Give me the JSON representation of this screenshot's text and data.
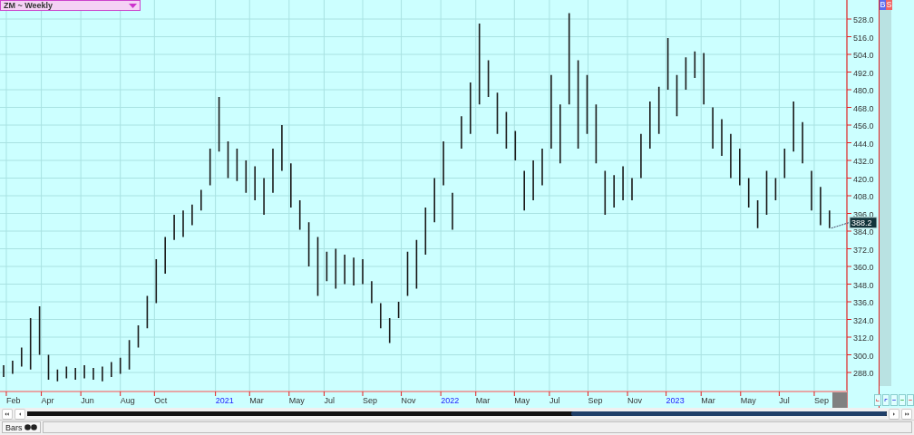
{
  "header": {
    "title": "ZM ~ Weekly"
  },
  "side_buttons": [
    {
      "label": "B",
      "color": "#5b6cf0"
    },
    {
      "label": "S",
      "color": "#f06464"
    }
  ],
  "chart": {
    "last_price": "388.2",
    "price_axis": [
      "528.0",
      "516.0",
      "504.0",
      "492.0",
      "480.0",
      "468.0",
      "456.0",
      "444.0",
      "432.0",
      "420.0",
      "408.0",
      "396.0",
      "384.0",
      "372.0",
      "360.0",
      "348.0",
      "336.0",
      "324.0",
      "312.0",
      "300.0",
      "288.0"
    ],
    "date_axis": [
      {
        "label": "Feb",
        "kind": "month"
      },
      {
        "label": "Apr",
        "kind": "month"
      },
      {
        "label": "Jun",
        "kind": "month"
      },
      {
        "label": "Aug",
        "kind": "month"
      },
      {
        "label": "Oct",
        "kind": "month"
      },
      {
        "label": "2021",
        "kind": "year"
      },
      {
        "label": "Mar",
        "kind": "month"
      },
      {
        "label": "May",
        "kind": "month"
      },
      {
        "label": "Jul",
        "kind": "month"
      },
      {
        "label": "Sep",
        "kind": "month"
      },
      {
        "label": "Nov",
        "kind": "month"
      },
      {
        "label": "2022",
        "kind": "year"
      },
      {
        "label": "Mar",
        "kind": "month"
      },
      {
        "label": "May",
        "kind": "month"
      },
      {
        "label": "Jul",
        "kind": "month"
      },
      {
        "label": "Sep",
        "kind": "month"
      },
      {
        "label": "Nov",
        "kind": "month"
      },
      {
        "label": "2023",
        "kind": "year"
      },
      {
        "label": "Mar",
        "kind": "month"
      },
      {
        "label": "May",
        "kind": "month"
      },
      {
        "label": "Jul",
        "kind": "month"
      },
      {
        "label": "Sep",
        "kind": "month"
      }
    ]
  },
  "status_bar": {
    "tab": "Bars"
  }
}
